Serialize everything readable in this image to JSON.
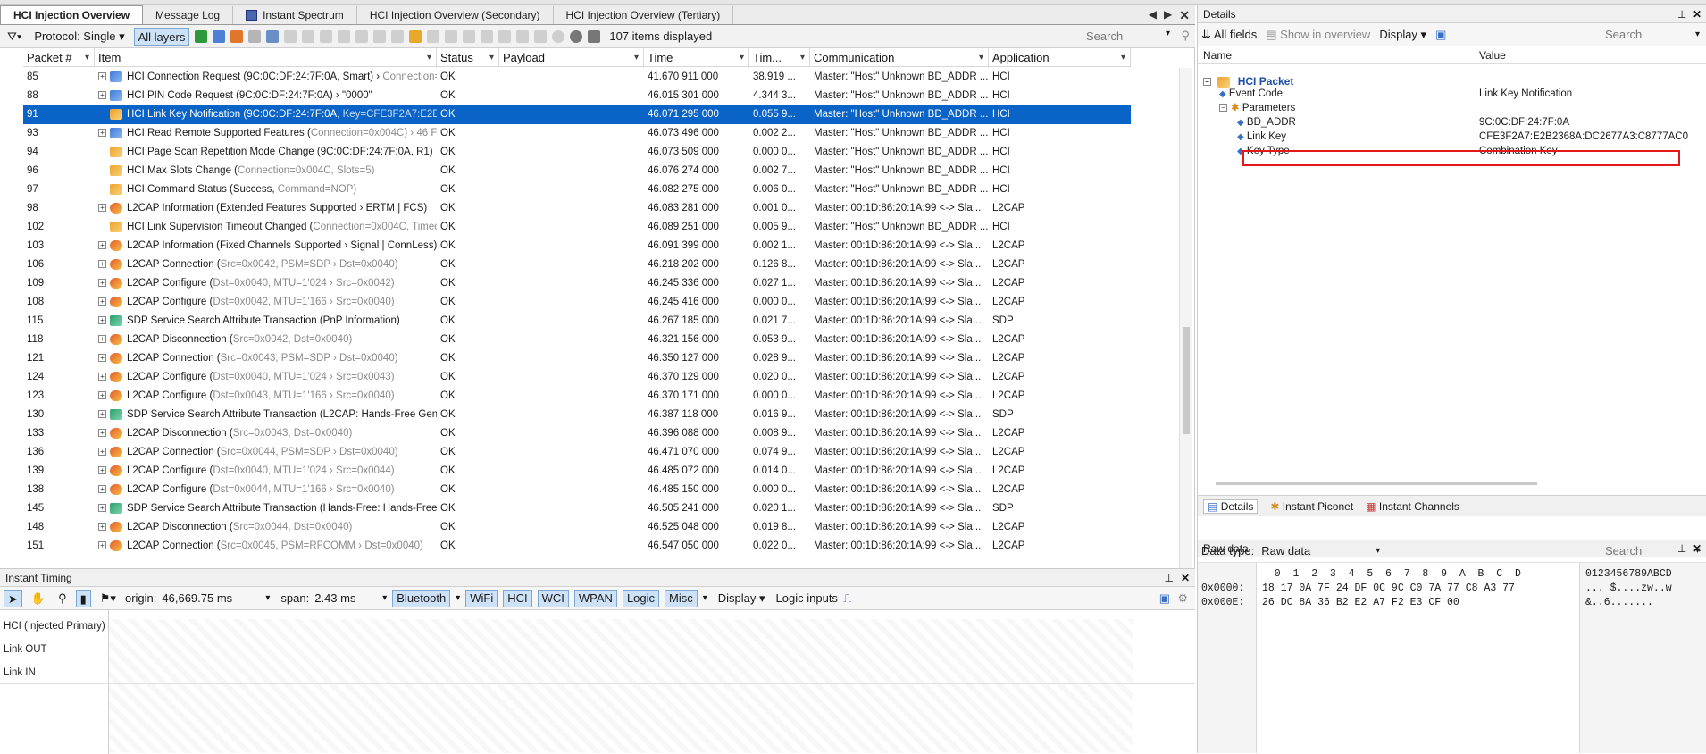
{
  "tabs": [
    {
      "label": "HCI Injection Overview",
      "active": true
    },
    {
      "label": "Message Log",
      "active": false
    },
    {
      "label": "Instant Spectrum",
      "active": false
    },
    {
      "label": "HCI Injection Overview (Secondary)",
      "active": false
    },
    {
      "label": "HCI Injection Overview (Tertiary)",
      "active": false
    }
  ],
  "toolbar": {
    "protocol_label": "Protocol: Single",
    "all_layers": "All layers",
    "items_displayed": "107 items displayed",
    "search_placeholder": "Search"
  },
  "columns": [
    "Packet #",
    "Item",
    "Status",
    "Payload",
    "Time",
    "Tim...",
    "Communication",
    "Application"
  ],
  "rows": [
    {
      "packet": "85",
      "expand": true,
      "icon": "hci",
      "item": "HCI Connection Request (9C:0C:DF:24:7F:0A, Smart) › ",
      "dim": "Connection=0...",
      "status": "OK",
      "payload": "",
      "time": "41.670 911 000",
      "delta": "38.919 ...",
      "comm": "Master: \"Host\" Unknown BD_ADDR ...",
      "app": "HCI",
      "selected": false
    },
    {
      "packet": "88",
      "expand": true,
      "icon": "hci",
      "item": "HCI PIN Code Request (9C:0C:DF:24:7F:0A) › \"0000\"",
      "dim": "",
      "status": "OK",
      "payload": "",
      "time": "46.015 301 000",
      "delta": "4.344 3...",
      "comm": "Master: \"Host\" Unknown BD_ADDR ...",
      "app": "HCI",
      "selected": false
    },
    {
      "packet": "91",
      "expand": false,
      "icon": "hcievt",
      "item": "HCI Link Key Notification (9C:0C:DF:24:7F:0A, ",
      "dim": "Key=CFE3F2A7:E2B...",
      "status": "OK",
      "payload": "",
      "time": "46.071 295 000",
      "delta": "0.055 9...",
      "comm": "Master: \"Host\" Unknown BD_ADDR ...",
      "app": "HCI",
      "selected": true
    },
    {
      "packet": "93",
      "expand": true,
      "icon": "hci",
      "item": "HCI Read Remote Supported Features (",
      "dim": "Connection=0x004C) › 46 F...",
      "status": "OK",
      "payload": "",
      "time": "46.073 496 000",
      "delta": "0.002 2...",
      "comm": "Master: \"Host\" Unknown BD_ADDR ...",
      "app": "HCI",
      "selected": false
    },
    {
      "packet": "94",
      "expand": false,
      "icon": "hcievt",
      "item": "HCI Page Scan Repetition Mode Change (9C:0C:DF:24:7F:0A, R1)",
      "dim": "",
      "status": "OK",
      "payload": "",
      "time": "46.073 509 000",
      "delta": "0.000 0...",
      "comm": "Master: \"Host\" Unknown BD_ADDR ...",
      "app": "HCI",
      "selected": false
    },
    {
      "packet": "96",
      "expand": false,
      "icon": "hcievt",
      "item": "HCI Max Slots Change (",
      "dim": "Connection=0x004C, Slots=5)",
      "status": "OK",
      "payload": "",
      "time": "46.076 274 000",
      "delta": "0.002 7...",
      "comm": "Master: \"Host\" Unknown BD_ADDR ...",
      "app": "HCI",
      "selected": false
    },
    {
      "packet": "97",
      "expand": false,
      "icon": "hcievt",
      "item": "HCI Command Status (Success, ",
      "dim": "Command=NOP)",
      "status": "OK",
      "payload": "",
      "time": "46.082 275 000",
      "delta": "0.006 0...",
      "comm": "Master: \"Host\" Unknown BD_ADDR ...",
      "app": "HCI",
      "selected": false
    },
    {
      "packet": "98",
      "expand": true,
      "icon": "l2",
      "item": "L2CAP Information (Extended Features Supported › ERTM | FCS)",
      "dim": "",
      "status": "OK",
      "payload": "",
      "time": "46.083 281 000",
      "delta": "0.001 0...",
      "comm": "Master: 00:1D:86:20:1A:99 <-> Sla...",
      "app": "L2CAP",
      "selected": false
    },
    {
      "packet": "102",
      "expand": false,
      "icon": "hcievt",
      "item": "HCI Link Supervision Timeout Changed (",
      "dim": "Connection=0x004C, Timeo...",
      "status": "OK",
      "payload": "",
      "time": "46.089 251 000",
      "delta": "0.005 9...",
      "comm": "Master: \"Host\" Unknown BD_ADDR ...",
      "app": "HCI",
      "selected": false
    },
    {
      "packet": "103",
      "expand": true,
      "icon": "l2",
      "item": "L2CAP Information (Fixed Channels Supported › Signal | ConnLess)",
      "dim": "",
      "status": "OK",
      "payload": "",
      "time": "46.091 399 000",
      "delta": "0.002 1...",
      "comm": "Master: 00:1D:86:20:1A:99 <-> Sla...",
      "app": "L2CAP",
      "selected": false
    },
    {
      "packet": "106",
      "expand": true,
      "icon": "l2",
      "item": "L2CAP Connection (",
      "dim": "Src=0x0042, PSM=SDP › Dst=0x0040)",
      "status": "OK",
      "payload": "",
      "time": "46.218 202 000",
      "delta": "0.126 8...",
      "comm": "Master: 00:1D:86:20:1A:99 <-> Sla...",
      "app": "L2CAP",
      "selected": false
    },
    {
      "packet": "109",
      "expand": true,
      "icon": "l2",
      "item": "L2CAP Configure (",
      "dim": "Dst=0x0040, MTU=1'024 › Src=0x0042)",
      "status": "OK",
      "payload": "",
      "time": "46.245 336 000",
      "delta": "0.027 1...",
      "comm": "Master: 00:1D:86:20:1A:99 <-> Sla...",
      "app": "L2CAP",
      "selected": false
    },
    {
      "packet": "108",
      "expand": true,
      "icon": "l2",
      "item": "L2CAP Configure (",
      "dim": "Dst=0x0042, MTU=1'166 › Src=0x0040)",
      "status": "OK",
      "payload": "",
      "time": "46.245 416 000",
      "delta": "0.000 0...",
      "comm": "Master: 00:1D:86:20:1A:99 <-> Sla...",
      "app": "L2CAP",
      "selected": false
    },
    {
      "packet": "115",
      "expand": true,
      "icon": "sdp",
      "item": "SDP Service Search Attribute Transaction (PnP Information)",
      "dim": "",
      "status": "OK",
      "payload": "",
      "time": "46.267 185 000",
      "delta": "0.021 7...",
      "comm": "Master: 00:1D:86:20:1A:99 <-> Sla...",
      "app": "SDP",
      "selected": false
    },
    {
      "packet": "118",
      "expand": true,
      "icon": "l2",
      "item": "L2CAP Disconnection (",
      "dim": "Src=0x0042, Dst=0x0040)",
      "status": "OK",
      "payload": "",
      "time": "46.321 156 000",
      "delta": "0.053 9...",
      "comm": "Master: 00:1D:86:20:1A:99 <-> Sla...",
      "app": "L2CAP",
      "selected": false
    },
    {
      "packet": "121",
      "expand": true,
      "icon": "l2",
      "item": "L2CAP Connection (",
      "dim": "Src=0x0043, PSM=SDP › Dst=0x0040)",
      "status": "OK",
      "payload": "",
      "time": "46.350 127 000",
      "delta": "0.028 9...",
      "comm": "Master: 00:1D:86:20:1A:99 <-> Sla...",
      "app": "L2CAP",
      "selected": false
    },
    {
      "packet": "124",
      "expand": true,
      "icon": "l2",
      "item": "L2CAP Configure (",
      "dim": "Dst=0x0040, MTU=1'024 › Src=0x0043)",
      "status": "OK",
      "payload": "",
      "time": "46.370 129 000",
      "delta": "0.020 0...",
      "comm": "Master: 00:1D:86:20:1A:99 <-> Sla...",
      "app": "L2CAP",
      "selected": false
    },
    {
      "packet": "123",
      "expand": true,
      "icon": "l2",
      "item": "L2CAP Configure (",
      "dim": "Dst=0x0043, MTU=1'166 › Src=0x0040)",
      "status": "OK",
      "payload": "",
      "time": "46.370 171 000",
      "delta": "0.000 0...",
      "comm": "Master: 00:1D:86:20:1A:99 <-> Sla...",
      "app": "L2CAP",
      "selected": false
    },
    {
      "packet": "130",
      "expand": true,
      "icon": "sdp",
      "item": "SDP Service Search Attribute Transaction (L2CAP: Hands-Free Gene...",
      "dim": "",
      "status": "OK",
      "payload": "",
      "time": "46.387 118 000",
      "delta": "0.016 9...",
      "comm": "Master: 00:1D:86:20:1A:99 <-> Sla...",
      "app": "SDP",
      "selected": false
    },
    {
      "packet": "133",
      "expand": true,
      "icon": "l2",
      "item": "L2CAP Disconnection (",
      "dim": "Src=0x0043, Dst=0x0040)",
      "status": "OK",
      "payload": "",
      "time": "46.396 088 000",
      "delta": "0.008 9...",
      "comm": "Master: 00:1D:86:20:1A:99 <-> Sla...",
      "app": "L2CAP",
      "selected": false
    },
    {
      "packet": "136",
      "expand": true,
      "icon": "l2",
      "item": "L2CAP Connection (",
      "dim": "Src=0x0044, PSM=SDP › Dst=0x0040)",
      "status": "OK",
      "payload": "",
      "time": "46.471 070 000",
      "delta": "0.074 9...",
      "comm": "Master: 00:1D:86:20:1A:99 <-> Sla...",
      "app": "L2CAP",
      "selected": false
    },
    {
      "packet": "139",
      "expand": true,
      "icon": "l2",
      "item": "L2CAP Configure (",
      "dim": "Dst=0x0040, MTU=1'024 › Src=0x0044)",
      "status": "OK",
      "payload": "",
      "time": "46.485 072 000",
      "delta": "0.014 0...",
      "comm": "Master: 00:1D:86:20:1A:99 <-> Sla...",
      "app": "L2CAP",
      "selected": false
    },
    {
      "packet": "138",
      "expand": true,
      "icon": "l2",
      "item": "L2CAP Configure (",
      "dim": "Dst=0x0044, MTU=1'166 › Src=0x0040)",
      "status": "OK",
      "payload": "",
      "time": "46.485 150 000",
      "delta": "0.000 0...",
      "comm": "Master: 00:1D:86:20:1A:99 <-> Sla...",
      "app": "L2CAP",
      "selected": false
    },
    {
      "packet": "145",
      "expand": true,
      "icon": "sdp",
      "item": "SDP Service Search Attribute Transaction (Hands-Free: Hands-Free ...",
      "dim": "",
      "status": "OK",
      "payload": "",
      "time": "46.505 241 000",
      "delta": "0.020 1...",
      "comm": "Master: 00:1D:86:20:1A:99 <-> Sla...",
      "app": "SDP",
      "selected": false
    },
    {
      "packet": "148",
      "expand": true,
      "icon": "l2",
      "item": "L2CAP Disconnection (",
      "dim": "Src=0x0044, Dst=0x0040)",
      "status": "OK",
      "payload": "",
      "time": "46.525 048 000",
      "delta": "0.019 8...",
      "comm": "Master: 00:1D:86:20:1A:99 <-> Sla...",
      "app": "L2CAP",
      "selected": false
    },
    {
      "packet": "151",
      "expand": true,
      "icon": "l2",
      "item": "L2CAP Connection (",
      "dim": "Src=0x0045, PSM=RFCOMM › Dst=0x0040)",
      "status": "OK",
      "payload": "",
      "time": "46.547 050 000",
      "delta": "0.022 0...",
      "comm": "Master: 00:1D:86:20:1A:99 <-> Sla...",
      "app": "L2CAP",
      "selected": false
    }
  ],
  "timing": {
    "title": "Instant Timing",
    "origin_label": "origin:",
    "origin_value": "46,669.75 ms",
    "span_label": "span:",
    "span_value": "2.43 ms",
    "protocols": [
      "Bluetooth",
      "WiFi",
      "HCI",
      "WCI",
      "WPAN",
      "Logic",
      "Misc"
    ],
    "display_label": "Display",
    "logic_inputs_label": "Logic inputs",
    "lanes": [
      "HCI (Injected Primary)",
      "Link OUT",
      "Link IN"
    ]
  },
  "details": {
    "title": "Details",
    "all_fields": "All fields",
    "show_in_overview": "Show in overview",
    "display": "Display",
    "search_placeholder": "Search",
    "col_name": "Name",
    "col_value": "Value",
    "root": "HCI Packet",
    "fields": [
      {
        "name": "Event Code",
        "value": "Link Key Notification",
        "indent": 1
      },
      {
        "name": "Parameters",
        "value": "",
        "indent": 1,
        "group": true
      },
      {
        "name": "BD_ADDR",
        "value": "9C:0C:DF:24:7F:0A",
        "indent": 2
      },
      {
        "name": "Link Key",
        "value": "CFE3F2A7:E2B2368A:DC2677A3:C8777AC0",
        "indent": 2,
        "highlight": true
      },
      {
        "name": "Key Type",
        "value": "Combination Key",
        "indent": 2
      }
    ],
    "bottom_tabs": [
      "Details",
      "Instant Piconet",
      "Instant Channels"
    ]
  },
  "raw": {
    "title": "Raw data",
    "data_type_label": "Data type:",
    "data_type_value": "Raw data",
    "search_placeholder": "Search",
    "header": "  0  1  2  3  4  5  6  7  8  9  A  B  C  D",
    "ascii_header": "0123456789ABCD",
    "offsets": [
      "0x0000:",
      "0x000E:"
    ],
    "lines": [
      "18 17 0A 7F 24 DF 0C 9C C0 7A 77 C8 A3 77",
      "26 DC 8A 36 B2 E2 A7 F2 E3 CF 00"
    ],
    "ascii": [
      "... $....zw..w",
      "&..6......."
    ]
  },
  "colors": {
    "selection": "#0a64c8",
    "highlight_box": "#e31919",
    "toggle_active": "#cde1f7"
  }
}
